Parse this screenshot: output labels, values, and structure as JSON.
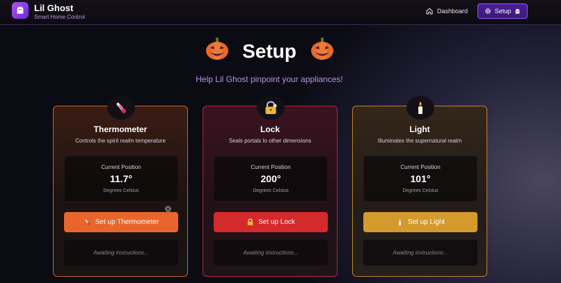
{
  "app": {
    "title": "Lil Ghost",
    "subtitle": "Smart Home Control"
  },
  "nav": {
    "dashboard_label": "Dashboard",
    "setup_label": "Setup"
  },
  "page": {
    "title": "Setup",
    "subtitle": "Help Lil Ghost pinpoint your appliances!"
  },
  "cards": [
    {
      "icon": "thermometer-icon",
      "title": "Thermometer",
      "description": "Controls the spirit realm temperature",
      "position_label": "Current Position",
      "position_value": "11.7°",
      "unit": "Degrees Celsius",
      "button_label": "Set up Thermometer",
      "status": "Awaiting instructions...",
      "accent": "#e8662c"
    },
    {
      "icon": "lock-icon",
      "title": "Lock",
      "description": "Seals portals to other dimensions",
      "position_label": "Current Position",
      "position_value": "200°",
      "unit": "Degrees Celsius",
      "button_label": "Set up Lock",
      "status": "Awaiting instructions...",
      "accent": "#d42a2c"
    },
    {
      "icon": "candle-icon",
      "title": "Light",
      "description": "Illuminates the supernatural realm",
      "position_label": "Current Position",
      "position_value": "101°",
      "unit": "Degrees Celsius",
      "button_label": "Set up Light",
      "status": "Awaiting instructions...",
      "accent": "#d49a2e"
    }
  ],
  "colors": {
    "brand": "#8b5cf6",
    "subtitle": "#b793e8"
  }
}
